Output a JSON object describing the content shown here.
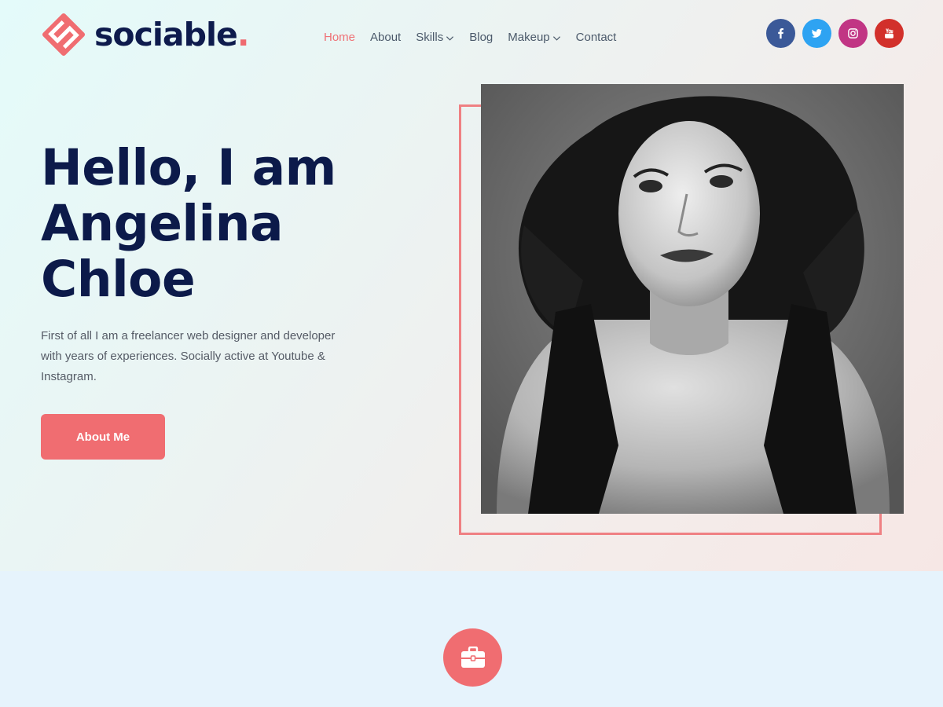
{
  "brand": {
    "name": "sociable",
    "dot": ".",
    "logo_icon": "s-diamond-logo-icon"
  },
  "nav": {
    "items": [
      {
        "label": "Home",
        "active": true,
        "dropdown": false
      },
      {
        "label": "About",
        "active": false,
        "dropdown": false
      },
      {
        "label": "Skills",
        "active": false,
        "dropdown": true
      },
      {
        "label": "Blog",
        "active": false,
        "dropdown": false
      },
      {
        "label": "Makeup",
        "active": false,
        "dropdown": true
      },
      {
        "label": "Contact",
        "active": false,
        "dropdown": false
      }
    ]
  },
  "socials": [
    {
      "network": "facebook",
      "icon": "facebook-icon",
      "color": "#3b5998"
    },
    {
      "network": "twitter",
      "icon": "twitter-icon",
      "color": "#2ea3f2"
    },
    {
      "network": "instagram",
      "icon": "instagram-icon",
      "color": "#c13584"
    },
    {
      "network": "youtube",
      "icon": "youtube-icon",
      "color": "#d2302b"
    }
  ],
  "hero": {
    "title": "Hello, I am Angelina Chloe",
    "description": "First of all I am a freelancer web designer and developer with years of experiences. Socially active at Youtube & Instagram.",
    "button_label": "About Me",
    "portrait": "black-and-white-portrait-photo"
  },
  "section": {
    "icon": "briefcase-icon"
  },
  "colors": {
    "accent": "#f06d71",
    "heading": "#0c1a4a",
    "body_text": "#555b66",
    "nav_text": "#4c5a6b",
    "lower_section_bg": "#e6f3fc"
  }
}
